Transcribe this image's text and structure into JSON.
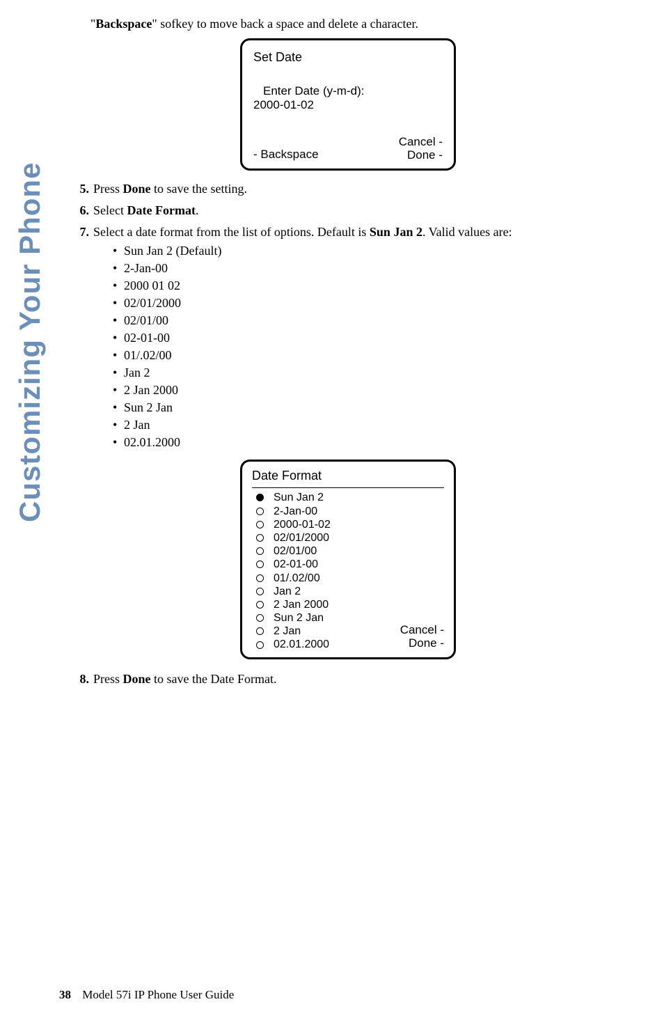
{
  "side_tab": "Customizing Your Phone",
  "intro_prefix": "\"",
  "intro_bold": "Backspace",
  "intro_suffix": "\" sofkey to move back a space and delete a character.",
  "phone1": {
    "title": "Set Date",
    "prompt": "Enter Date (y-m-d):",
    "value": "2000-01-02",
    "backspace": "- Backspace",
    "cancel": "Cancel -",
    "done": "Done -"
  },
  "step5": {
    "num": "5.",
    "pre": "Press ",
    "bold": "Done",
    "post": " to save the setting."
  },
  "step6": {
    "num": "6.",
    "pre": "Select ",
    "bold": "Date Format",
    "post": "."
  },
  "step7": {
    "num": "7.",
    "pre": "Select a date format from the list of options. Default is ",
    "bold": "Sun Jan 2",
    "post": ". Valid values are:"
  },
  "formats": [
    "Sun Jan 2 (Default)",
    "2-Jan-00",
    "2000 01 02",
    "02/01/2000",
    "02/01/00",
    "02-01-00",
    "01/.02/00",
    "Jan 2",
    "2 Jan 2000",
    "Sun 2 Jan",
    "2 Jan",
    "02.01.2000"
  ],
  "phone2": {
    "title": "Date Format",
    "options": [
      {
        "label": "Sun Jan 2",
        "selected": true
      },
      {
        "label": "2-Jan-00",
        "selected": false
      },
      {
        "label": "2000-01-02",
        "selected": false
      },
      {
        "label": "02/01/2000",
        "selected": false
      },
      {
        "label": "02/01/00",
        "selected": false
      },
      {
        "label": "02-01-00",
        "selected": false
      },
      {
        "label": "01/.02/00",
        "selected": false
      },
      {
        "label": "Jan 2",
        "selected": false
      },
      {
        "label": "2 Jan 2000",
        "selected": false
      },
      {
        "label": "Sun 2 Jan",
        "selected": false
      },
      {
        "label": "2 Jan",
        "selected": false
      },
      {
        "label": "02.01.2000",
        "selected": false
      }
    ],
    "cancel": "Cancel -",
    "done": "Done -"
  },
  "step8": {
    "num": "8.",
    "pre": "Press ",
    "bold": "Done",
    "post": " to save the Date Format."
  },
  "footer": {
    "page": "38",
    "text": "Model 57i IP Phone User Guide"
  }
}
